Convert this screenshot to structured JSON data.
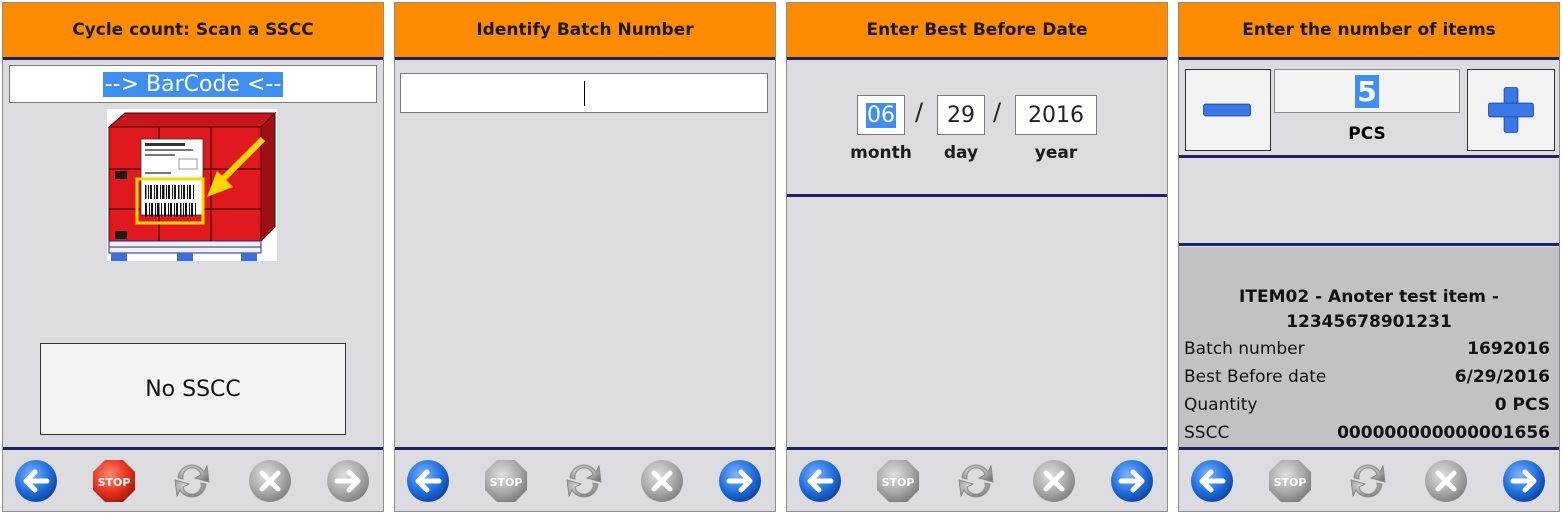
{
  "panels": [
    {
      "title": "Cycle count: Scan a SSCC",
      "barcode_value": "--> BarCode <--",
      "no_sscc_label": "No SSCC",
      "footer": {
        "back": "back-icon",
        "stop": "STOP",
        "refresh": "refresh-icon",
        "cancel": "cancel-icon",
        "next": "next-icon"
      }
    },
    {
      "title": "Identify Batch Number",
      "batch_value": "",
      "footer": {
        "stop": "STOP"
      }
    },
    {
      "title": "Enter Best Before Date",
      "month": "06",
      "day": "29",
      "year": "2016",
      "slash": "/",
      "month_label": "month",
      "day_label": "day",
      "year_label": "year",
      "footer": {
        "stop": "STOP"
      }
    },
    {
      "title": "Enter the number of items",
      "quantity": "5",
      "unit": "PCS",
      "item_line1": "ITEM02 - Anoter test item -",
      "item_line2": "12345678901231",
      "details": [
        {
          "label": "Batch number",
          "value": "1692016"
        },
        {
          "label": "Best Before date",
          "value": "6/29/2016"
        },
        {
          "label": "Quantity",
          "value": "0 PCS"
        },
        {
          "label": "SSCC",
          "value": "000000000000001656"
        }
      ],
      "footer": {
        "stop": "STOP"
      }
    }
  ],
  "colors": {
    "title_bar": "#fe8b00",
    "panel_bg": "#dcdbe0",
    "divider": "#1b2368",
    "selection": "#3f8ff0",
    "active_icon": "#1f6fe0",
    "stop_active": "#e8321e",
    "disabled_icon": "#a9a9a9"
  }
}
